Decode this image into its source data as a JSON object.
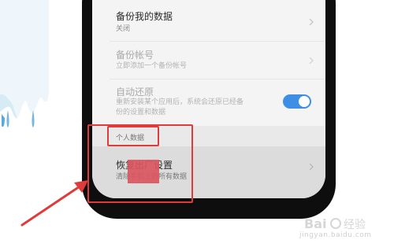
{
  "settings": {
    "items": [
      {
        "title": "备份我的数据",
        "subtitle": "关闭"
      },
      {
        "title": "备份帐号",
        "subtitle": "立即添加一个备份帐号"
      },
      {
        "title": "自动还原",
        "subtitle_line1": "重新安装某个应用后，系统会还原已经备",
        "subtitle_line2": "份的设置和数据"
      }
    ],
    "auto_restore_enabled": true,
    "section_label": "个人数据",
    "reset": {
      "title": "恢复出厂设置",
      "subtitle": "清除手机上的所有数据"
    }
  },
  "watermark": {
    "text": "jingyan.baidu.com"
  },
  "colors": {
    "annotation_red": "#e03b3b",
    "toggle_blue": "#3f8ee6",
    "highlight_pink": "#d9555e"
  }
}
